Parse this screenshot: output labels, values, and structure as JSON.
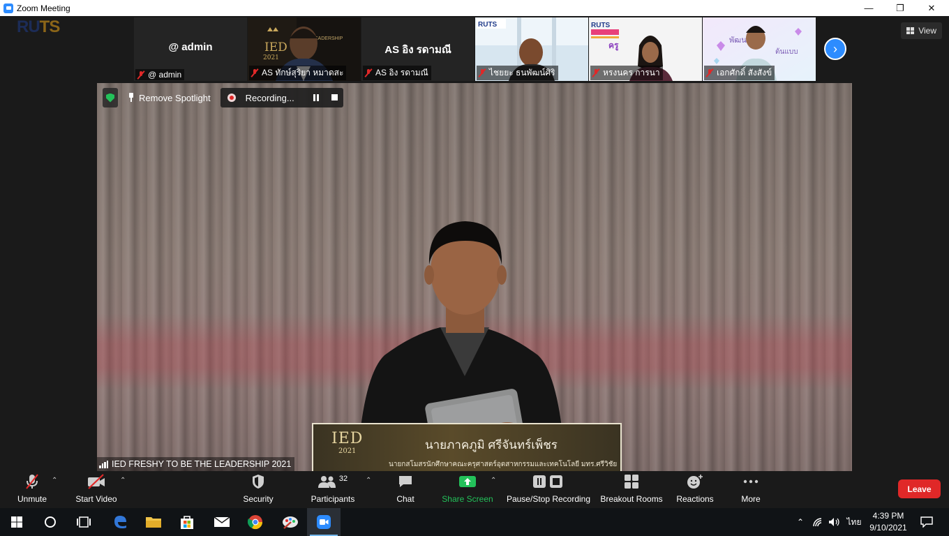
{
  "window": {
    "title": "Zoom Meeting",
    "minimize_icon": "minimize-icon",
    "restore_icon": "restore-icon",
    "close_icon": "close-icon"
  },
  "view_button": {
    "label": "View"
  },
  "gallery": [
    {
      "name": "@ admin",
      "label": "@ admin",
      "video": false
    },
    {
      "name": "AS ทักษ์สุริยา  หมาดสะ",
      "label": "AS ทักษ์สุริยา  หมาดสะ",
      "video": true
    },
    {
      "name": "AS อิง รดามณี",
      "label": "AS อิง รดามณี",
      "video": false
    },
    {
      "name": "ไชยยะ ธนพัฒน์ศิริ",
      "label": "ไชยยะ ธนพัฒน์ศิริ",
      "video": true
    },
    {
      "name": "หรงนคร การนา",
      "label": "หรงนคร การนา",
      "video": true
    },
    {
      "name": "เอกศักดิ์ สังสังข์",
      "label": "เอกศักดิ์ สังสังข์",
      "video": true
    }
  ],
  "spotlight": {
    "remove_label": "Remove Spotlight",
    "recording_label": "Recording..."
  },
  "main_video": {
    "meeting_name": "IED FRESHY TO BE THE LEADERSHIP 2021",
    "lower_third": {
      "logo": "IED",
      "logo_year": "2021",
      "name": "นายภาคภูมิ ศรีจันทร์เพ็ชร",
      "subtitle": "นายกสโมสรนักศึกษาคณะครุศาสตร์อุตสาหกรรมและเทคโนโลยี มทร.ศรีวิชัย"
    }
  },
  "toolbar": {
    "unmute": "Unmute",
    "start_video": "Start Video",
    "security": "Security",
    "participants": "Participants",
    "participants_count": "32",
    "chat": "Chat",
    "share_screen": "Share Screen",
    "pause_stop_recording": "Pause/Stop Recording",
    "breakout_rooms": "Breakout Rooms",
    "reactions": "Reactions",
    "more": "More",
    "leave": "Leave"
  },
  "colors": {
    "accent": "#2d8cff",
    "share_green": "#23c15a",
    "leave_red": "#e02828"
  },
  "taskbar": {
    "language": "ไทย",
    "time": "4:39 PM",
    "date": "9/10/2021"
  }
}
